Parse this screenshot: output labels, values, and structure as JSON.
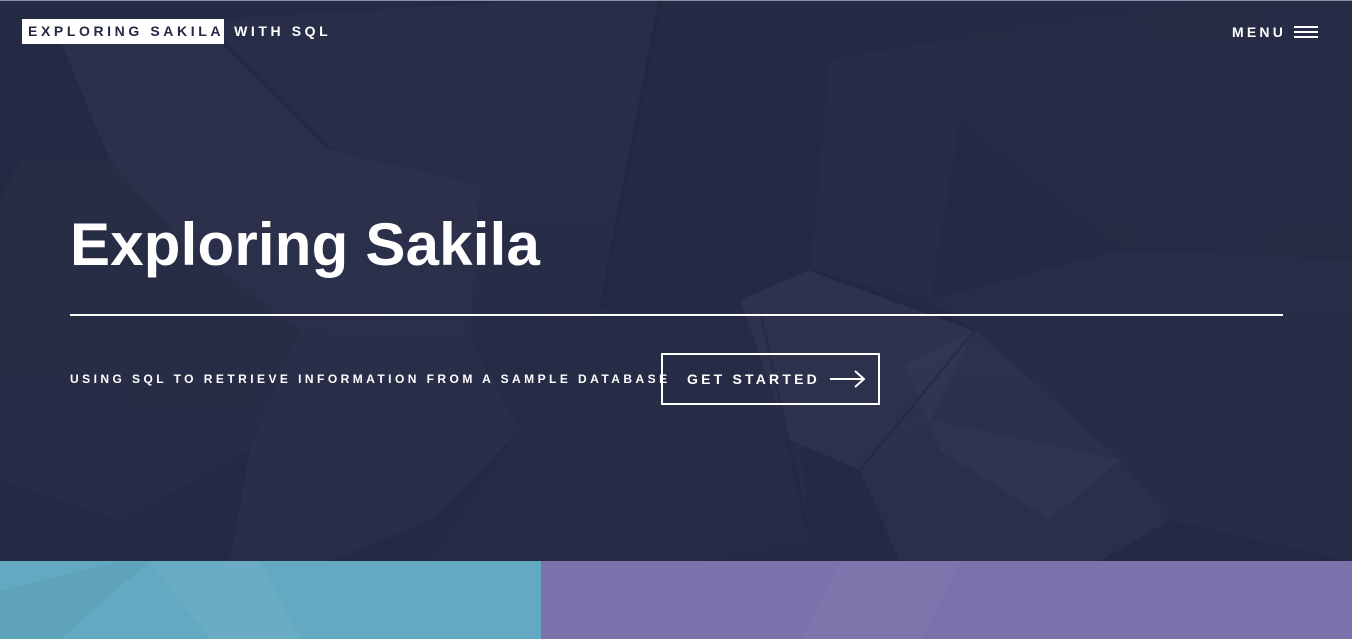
{
  "header": {
    "logo_primary": "EXPLORING SAKILA",
    "logo_secondary": "WITH SQL",
    "menu_label": "MENU",
    "menu_icon": "hamburger-icon"
  },
  "banner": {
    "title": "Exploring Sakila",
    "subtitle": "USING SQL TO RETRIEVE INFORMATION FROM A SAMPLE DATABASE",
    "cta_label": "GET STARTED",
    "cta_icon": "arrow-right-icon"
  },
  "tiles": [
    {
      "color": "#63a9c2"
    },
    {
      "color": "#7b71ab"
    }
  ],
  "colors": {
    "background": "#242943",
    "accent_text": "#ffffff"
  }
}
